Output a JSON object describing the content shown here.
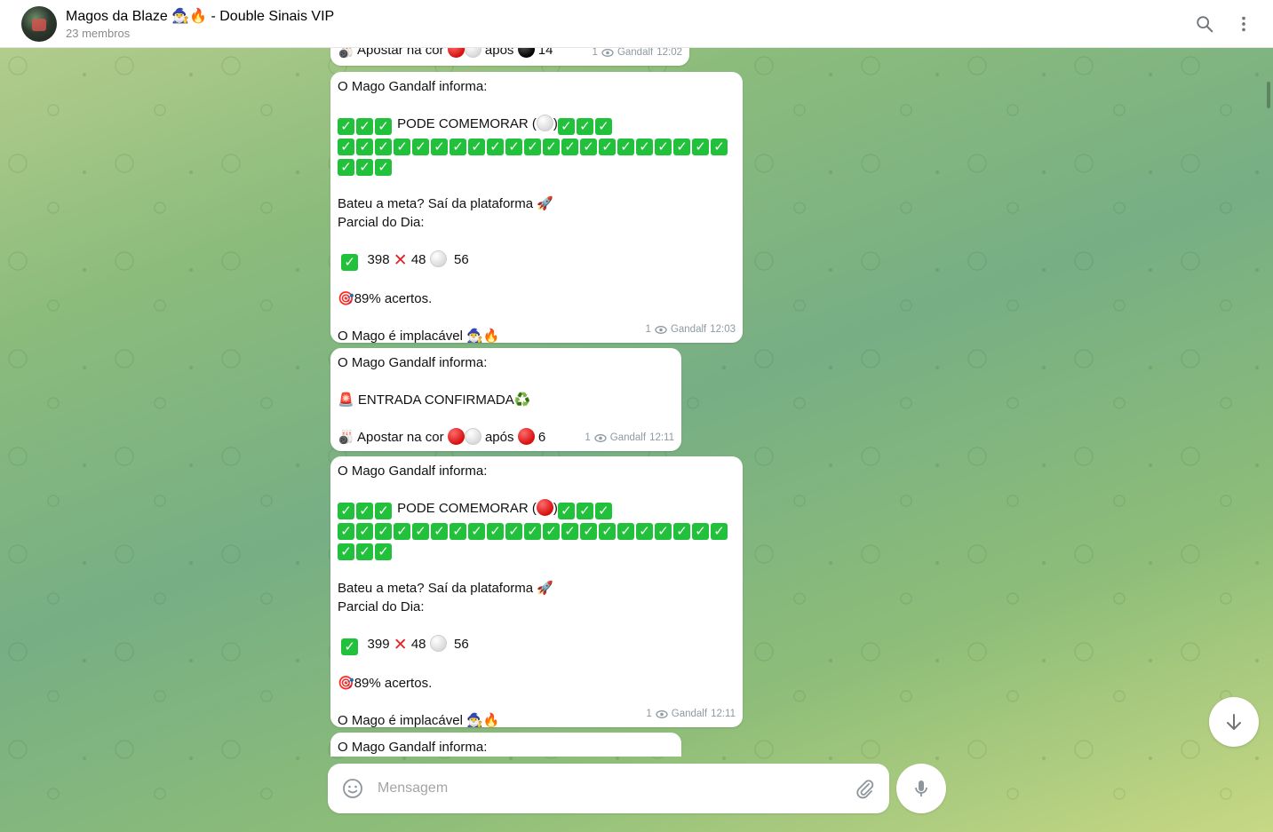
{
  "header": {
    "title": "Magos da Blaze 🧙‍♂️🔥 - Double Sinais VIP",
    "members": "23 membros"
  },
  "messages": [
    {
      "id": "m0",
      "partial_line": "Apostar na cor",
      "after_text": "após",
      "number": "14",
      "views": "1",
      "author": "Gandalf",
      "time": "12:02"
    },
    {
      "id": "m1",
      "intro": "O Mago Gandalf informa:",
      "celebrate": "PODE COMEMORAR (",
      "celebrate_close": ")",
      "goal": "Bateu a meta? Saí da plataforma 🚀",
      "partial_label": "Parcial do Dia:",
      "wins": "398",
      "losses": "48",
      "whites": "56",
      "accuracy": "89%  acertos.",
      "signature": "O Mago é implacável 🧙‍♂️🔥",
      "views": "1",
      "author": "Gandalf",
      "time": "12:03"
    },
    {
      "id": "m2",
      "intro": "O Mago Gandalf informa:",
      "entry": "ENTRADA CONFIRMADA♻️",
      "bet_text": "Apostar na cor",
      "after_text": "após",
      "number": "6",
      "views": "1",
      "author": "Gandalf",
      "time": "12:11"
    },
    {
      "id": "m3",
      "intro": "O Mago Gandalf informa:",
      "celebrate": "PODE COMEMORAR (",
      "celebrate_close": ")",
      "goal": "Bateu a meta? Saí da plataforma 🚀",
      "partial_label": "Parcial do Dia:",
      "wins": "399",
      "losses": "48",
      "whites": "56",
      "accuracy": "89%  acertos.",
      "signature": "O Mago é implacável 🧙‍♂️🔥",
      "views": "1",
      "author": "Gandalf",
      "time": "12:11"
    },
    {
      "id": "m4",
      "intro": "O Mago Gandalf informa:"
    }
  ],
  "composer": {
    "placeholder": "Mensagem"
  },
  "icons": {
    "search": "search-icon",
    "more": "more-vertical-icon",
    "emoji": "smile-icon",
    "attach": "paperclip-icon",
    "mic": "microphone-icon",
    "scroll_down": "arrow-down-icon",
    "views": "eye-icon"
  },
  "colors": {
    "check_green": "#22c13b",
    "cross_red": "#e0262a",
    "muted": "#8a8a8a"
  }
}
